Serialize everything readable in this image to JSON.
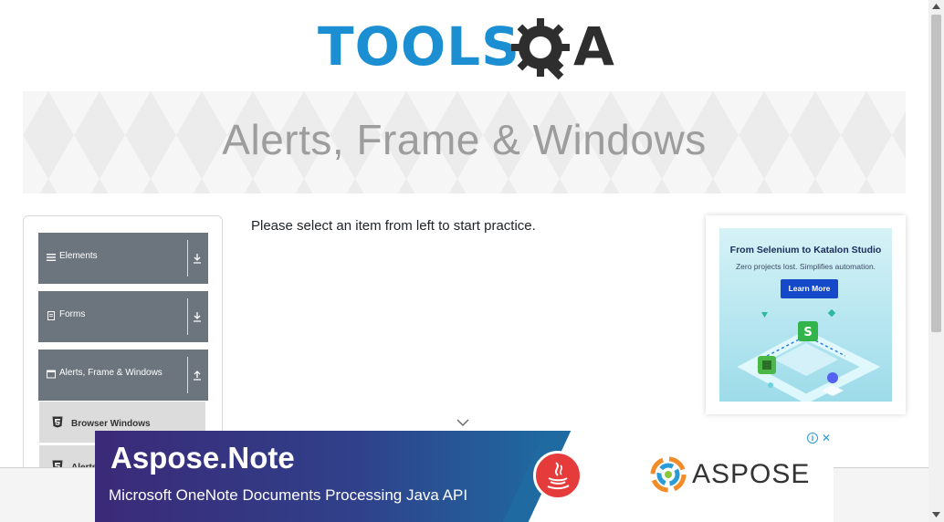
{
  "logo": {
    "brand_left": "TOOLS",
    "brand_right": "A"
  },
  "banner": {
    "title": "Alerts, Frame & Windows"
  },
  "sidebar": {
    "groups": [
      {
        "label": "Elements",
        "icon": "menu-lines-icon",
        "state": "collapsed"
      },
      {
        "label": "Forms",
        "icon": "form-icon",
        "state": "collapsed"
      },
      {
        "label": "Alerts, Frame & Windows",
        "icon": "window-icon",
        "state": "expanded"
      }
    ],
    "items": [
      {
        "label": "Browser Windows",
        "icon": "html5-icon"
      },
      {
        "label": "Alerts",
        "icon": "html5-icon"
      }
    ]
  },
  "main": {
    "message": "Please select an item from left to start practice."
  },
  "right_ad": {
    "title": "From Selenium to Katalon Studio",
    "subtitle": "Zero projects lost. Simplifies automation.",
    "button": "Learn More"
  },
  "bottom_ad": {
    "title": "Aspose.Note",
    "subtitle": "Microsoft OneNote Documents Processing  Java API",
    "brand": "ASPOSE",
    "adchoices_label": "i",
    "close_label": "✕"
  },
  "colors": {
    "brand_blue": "#1b8fd2",
    "sidebar_header": "#6c757d",
    "ad_button": "#1449c9"
  }
}
